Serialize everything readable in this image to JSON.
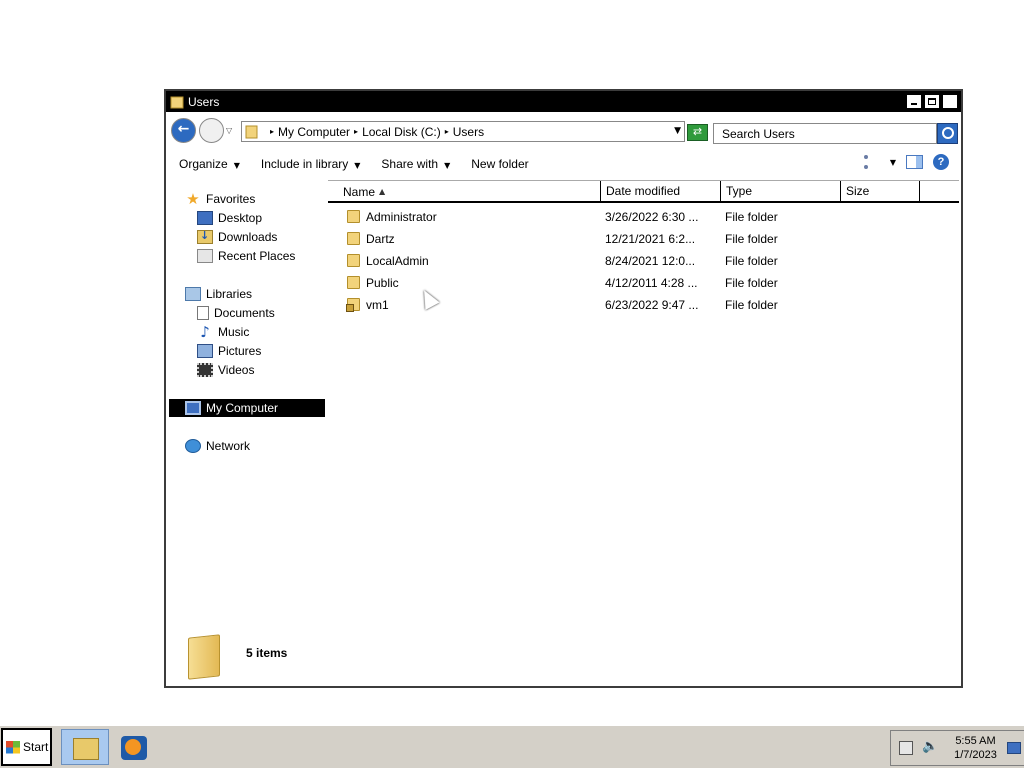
{
  "window": {
    "title": "Users"
  },
  "address": {
    "breadcrumbs": [
      "My Computer",
      "Local Disk (C:)",
      "Users"
    ],
    "search_placeholder": "Search Users"
  },
  "toolbar": {
    "organize": "Organize",
    "include_in_library": "Include in library",
    "share_with": "Share with",
    "new_folder": "New folder"
  },
  "nav": {
    "favorites": "Favorites",
    "desktop": "Desktop",
    "downloads": "Downloads",
    "recent_places": "Recent Places",
    "libraries": "Libraries",
    "documents": "Documents",
    "music": "Music",
    "pictures": "Pictures",
    "videos": "Videos",
    "my_computer": "My Computer",
    "network": "Network"
  },
  "columns": {
    "name": "Name",
    "date_modified": "Date modified",
    "type": "Type",
    "size": "Size"
  },
  "files": [
    {
      "name": "Administrator",
      "date": "3/26/2022 6:30 ...",
      "type": "File folder",
      "size": ""
    },
    {
      "name": "Dartz",
      "date": "12/21/2021 6:2...",
      "type": "File folder",
      "size": ""
    },
    {
      "name": "LocalAdmin",
      "date": "8/24/2021 12:0...",
      "type": "File folder",
      "size": ""
    },
    {
      "name": "Public",
      "date": "4/12/2011 4:28 ...",
      "type": "File folder",
      "size": ""
    },
    {
      "name": "vm1",
      "date": "6/23/2022 9:47 ...",
      "type": "File folder",
      "size": ""
    }
  ],
  "details": {
    "item_count": "5 items"
  },
  "taskbar": {
    "start_label": "Start",
    "time": "5:55 AM",
    "date": "1/7/2023"
  }
}
